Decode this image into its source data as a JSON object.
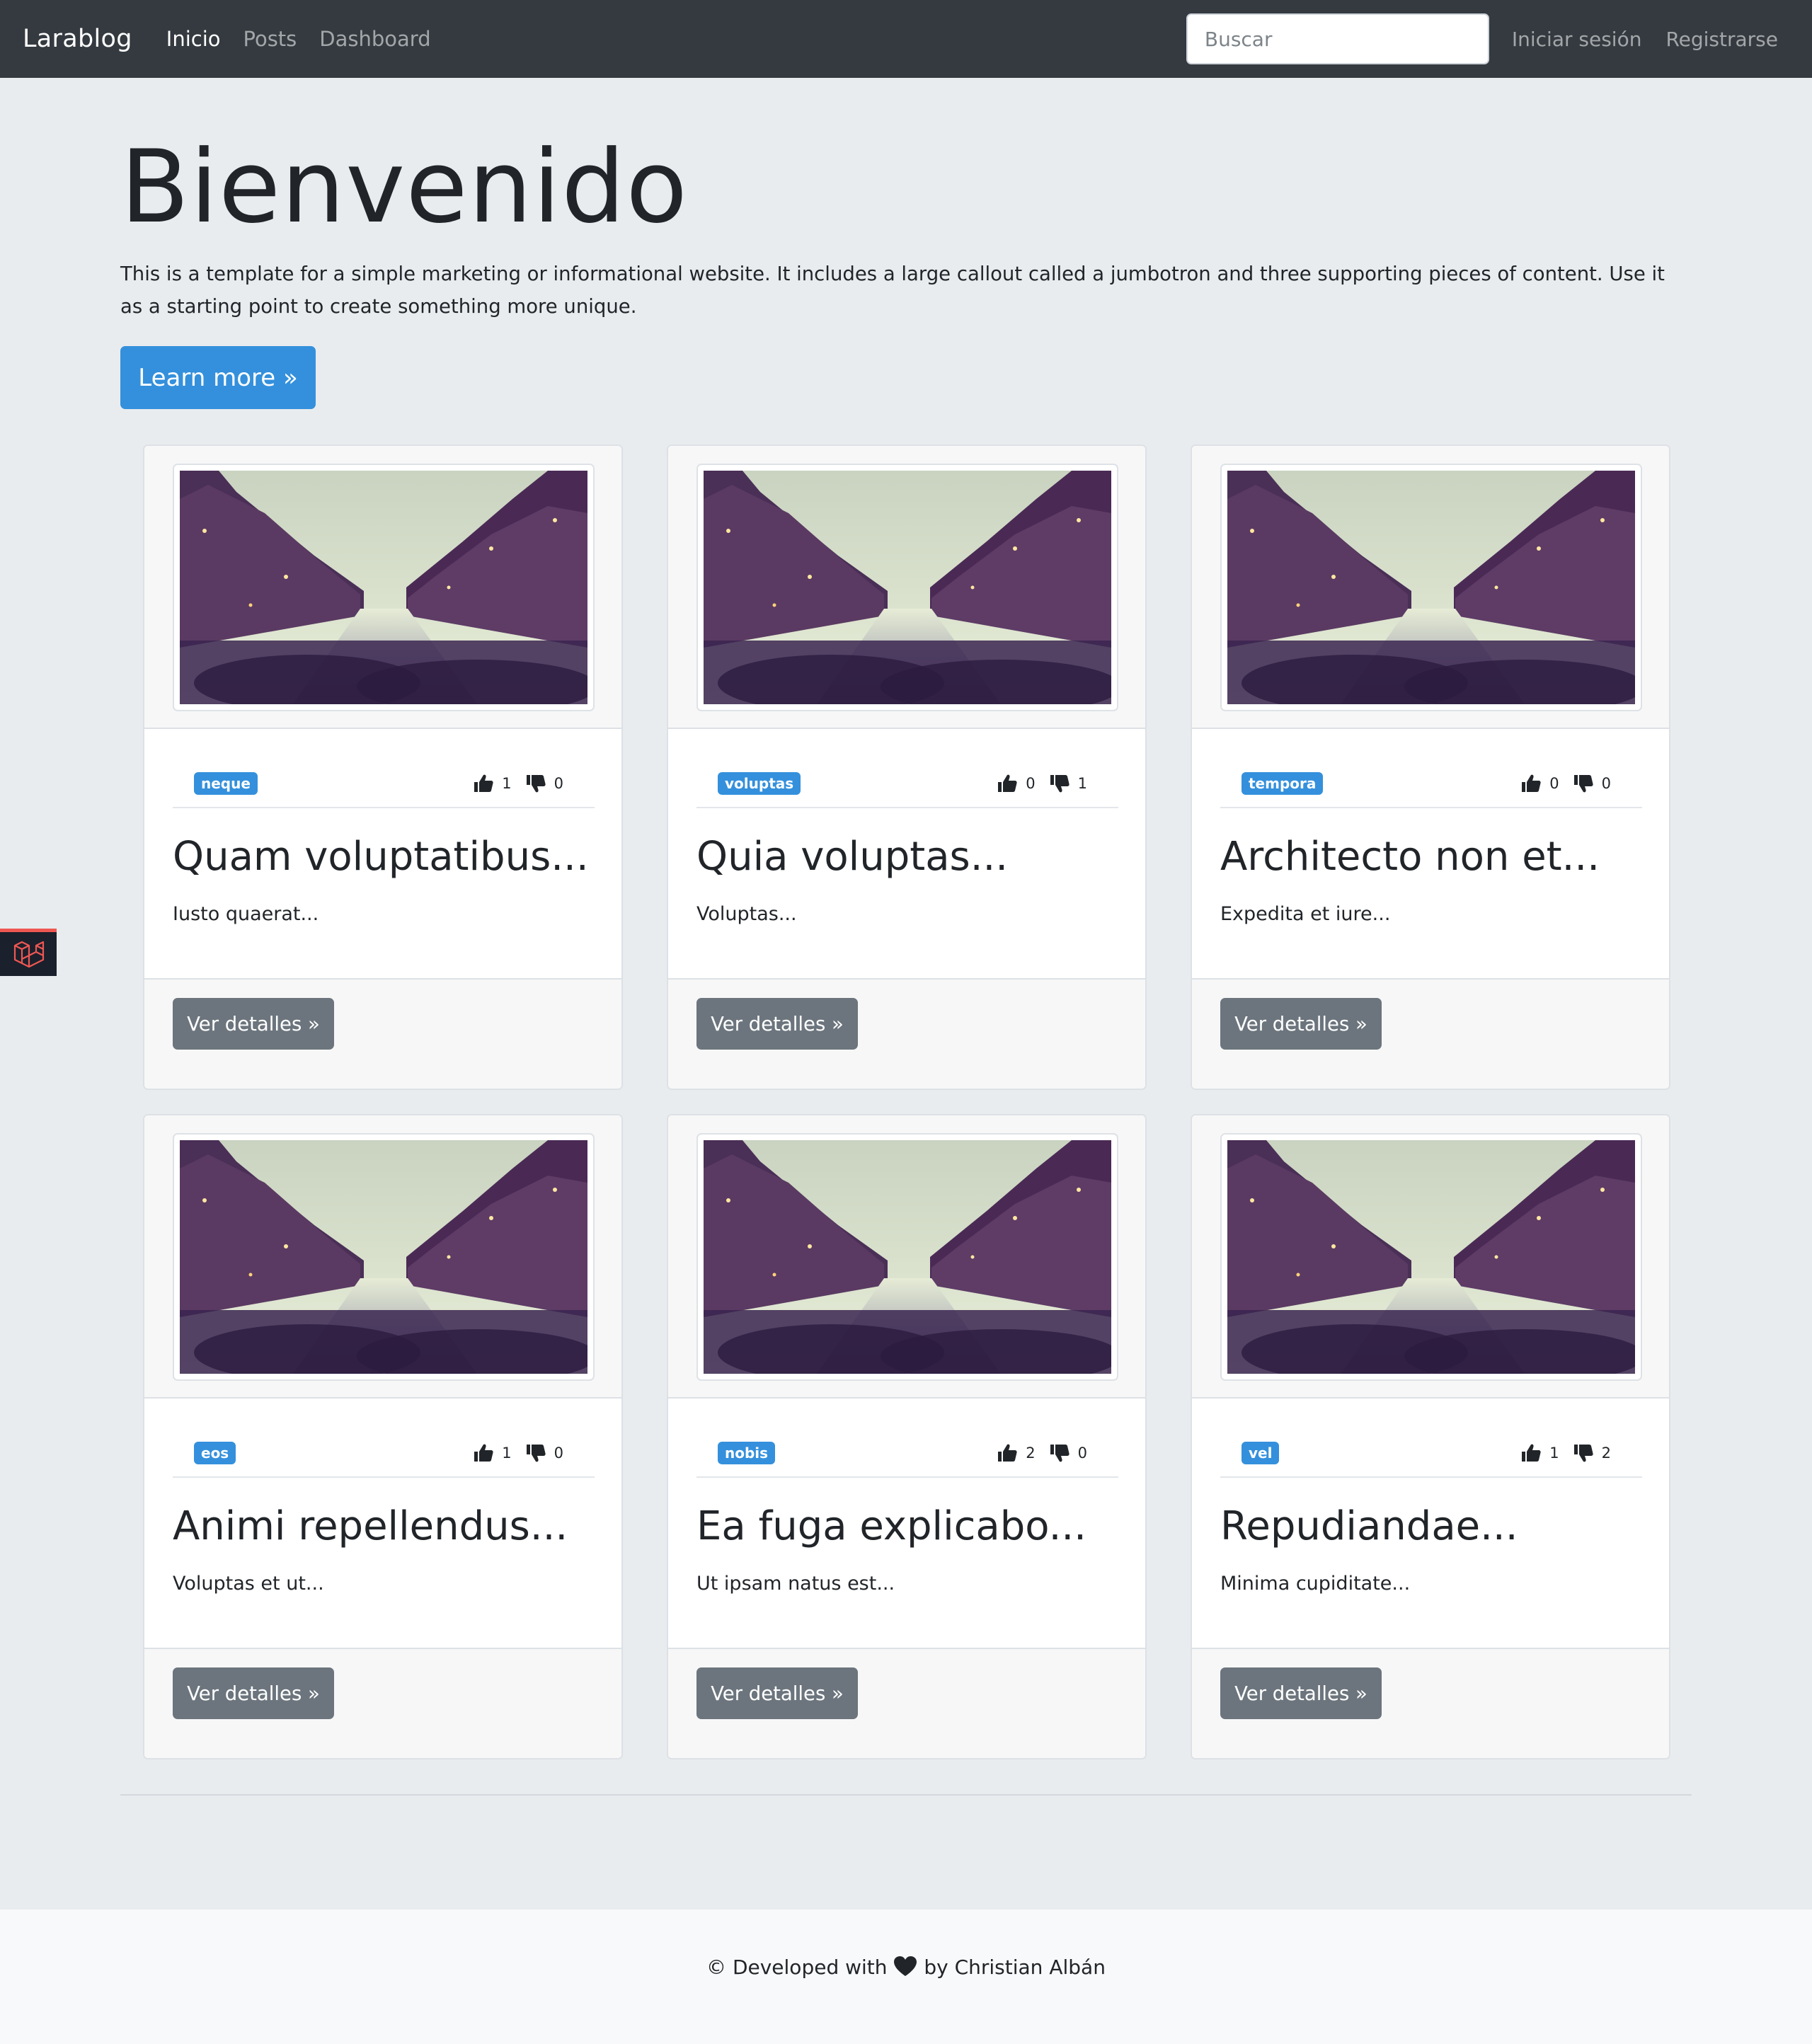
{
  "navbar": {
    "brand": "Larablog",
    "links": [
      "Inicio",
      "Posts",
      "Dashboard"
    ],
    "search_placeholder": "Buscar",
    "login": "Iniciar sesión",
    "register": "Registrarse"
  },
  "jumbotron": {
    "title": "Bienvenido",
    "text": "This is a template for a simple marketing or informational website. It includes a large callout called a jumbotron and three supporting pieces of content. Use it as a starting point to create something more unique.",
    "button": "Learn more »"
  },
  "posts": [
    {
      "tag": "neque",
      "likes": "1",
      "dislikes": "0",
      "title": "Quam voluptatibus...",
      "excerpt": "Iusto quaerat...",
      "button": "Ver detalles »"
    },
    {
      "tag": "voluptas",
      "likes": "0",
      "dislikes": "1",
      "title": "Quia voluptas...",
      "excerpt": "Voluptas...",
      "button": "Ver detalles »"
    },
    {
      "tag": "tempora",
      "likes": "0",
      "dislikes": "0",
      "title": "Architecto non et...",
      "excerpt": "Expedita et iure...",
      "button": "Ver detalles »"
    },
    {
      "tag": "eos",
      "likes": "1",
      "dislikes": "0",
      "title": "Animi repellendus...",
      "excerpt": "Voluptas et ut...",
      "button": "Ver detalles »"
    },
    {
      "tag": "nobis",
      "likes": "2",
      "dislikes": "0",
      "title": "Ea fuga explicabo...",
      "excerpt": "Ut ipsam natus est...",
      "button": "Ver detalles »"
    },
    {
      "tag": "vel",
      "likes": "1",
      "dislikes": "2",
      "title": "Repudiandae...",
      "excerpt": "Minima cupiditate...",
      "button": "Ver detalles »"
    }
  ],
  "footer": {
    "before_heart": "© Developed with",
    "after_heart": "by Christian Albán"
  },
  "icons": {
    "like": "thumbs-up-icon",
    "dislike": "thumbs-down-icon",
    "heart": "heart-icon",
    "debug": "laravel-logo-icon"
  },
  "colors": {
    "navbar": "#343a40",
    "primary": "#3490dc",
    "secondary": "#6c757d",
    "page_bg": "#e9ecef",
    "debug_accent": "#ef5753"
  }
}
